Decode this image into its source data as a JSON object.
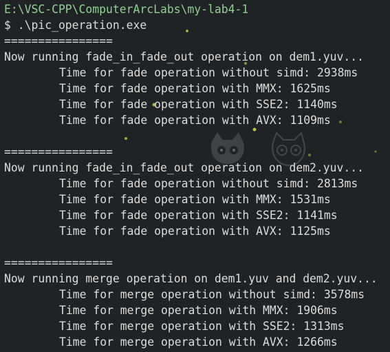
{
  "terminal": {
    "accent_path_color": "#8fd18f",
    "text_color": "#dcdcdc",
    "background_color": "#1f2326",
    "path": "E:\\VSC-CPP\\ComputerArcLabs\\my-lab4-1",
    "prompt_line": "$ .\\pic_operation.exe",
    "blocks": [
      {
        "separator": "================",
        "header": "Now running fade_in_fade_out operation on dem1.yuv...",
        "results": [
          "Time for fade operation without simd: 2938ms",
          "Time for fade operation with MMX: 1625ms",
          "Time for fade operation with SSE2: 1140ms",
          "Time for fade operation with AVX: 1109ms"
        ]
      },
      {
        "separator": "================",
        "header": "Now running fade_in_fade_out operation on dem2.yuv...",
        "results": [
          "Time for fade operation without simd: 2813ms",
          "Time for fade operation with MMX: 1531ms",
          "Time for fade operation with SSE2: 1141ms",
          "Time for fade operation with AVX: 1125ms"
        ]
      },
      {
        "separator": "================",
        "header": "Now running merge operation on dem1.yuv and dem2.yuv...",
        "results": [
          "Time for merge operation without simd: 3578ms",
          "Time for merge operation with MMX: 1906ms",
          "Time for merge operation with SSE2: 1313ms",
          "Time for merge operation with AVX: 1266ms"
        ]
      }
    ]
  }
}
